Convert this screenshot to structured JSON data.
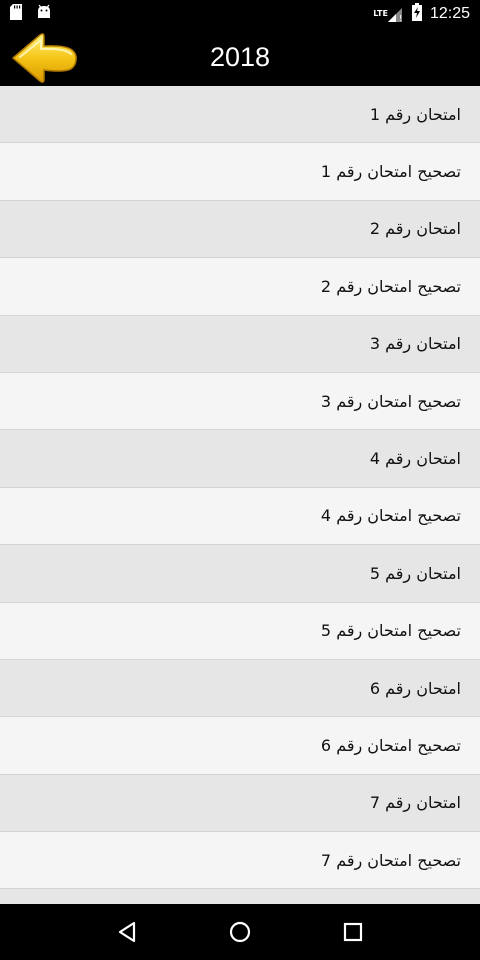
{
  "status_bar": {
    "time": "12:25",
    "network": "LTE",
    "icons": [
      "sd-card-icon",
      "android-icon",
      "signal-icon",
      "battery-charging-icon"
    ]
  },
  "app_bar": {
    "title": "2018",
    "back_icon": "back-arrow-icon",
    "accent_color": "#f5c518"
  },
  "list": {
    "items": [
      {
        "label": "امتحان رقم 1"
      },
      {
        "label": "تصحيح امتحان رقم 1"
      },
      {
        "label": "امتحان رقم 2"
      },
      {
        "label": "تصحيح امتحان رقم 2"
      },
      {
        "label": "امتحان رقم 3"
      },
      {
        "label": "تصحيح امتحان رقم 3"
      },
      {
        "label": "امتحان رقم 4"
      },
      {
        "label": "تصحيح امتحان رقم 4"
      },
      {
        "label": "امتحان رقم 5"
      },
      {
        "label": "تصحيح امتحان رقم 5"
      },
      {
        "label": "امتحان رقم 6"
      },
      {
        "label": "تصحيح امتحان رقم 6"
      },
      {
        "label": "امتحان رقم 7"
      },
      {
        "label": "تصحيح امتحان رقم 7"
      }
    ]
  },
  "nav_bar": {
    "icons": [
      "nav-back-icon",
      "nav-home-icon",
      "nav-recents-icon"
    ]
  }
}
